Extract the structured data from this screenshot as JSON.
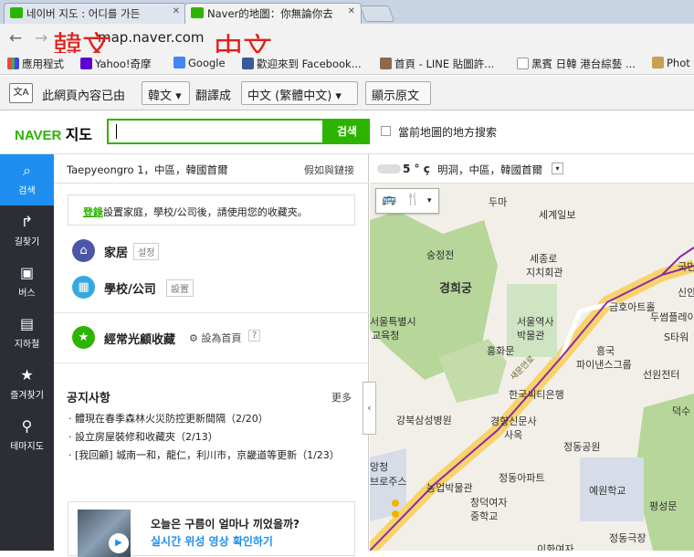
{
  "browser": {
    "tabs": [
      {
        "title": "네이버 지도 : 어디를 가든"
      },
      {
        "title": "Naver的地圖：你無論你去"
      }
    ],
    "url": "map.naver.com",
    "overlay_korean": "韓文",
    "overlay_chinese": "中文",
    "bookmarks": [
      {
        "label": "應用程式"
      },
      {
        "label": "Yahoo!奇摩"
      },
      {
        "label": "Google"
      },
      {
        "label": "歡迎來到 Facebook..."
      },
      {
        "label": "首頁 - LINE 貼圖許..."
      },
      {
        "label": "黑賓 日韓 港台綜藝 ..."
      },
      {
        "label": "Phot"
      }
    ]
  },
  "translate_bar": {
    "text1": "此網頁內容已由",
    "source_lang": "韓文",
    "text2": "翻譯成",
    "target_lang": "中文 (繁體中文)",
    "show_original": "顯示原文"
  },
  "header": {
    "logo": "NAVER",
    "logo_suffix": "지도",
    "search_button": "검색",
    "nearby_label": "當前地圖的地方搜索"
  },
  "nav": [
    {
      "label": "검색",
      "icon": "search-icon"
    },
    {
      "label": "길찾기",
      "icon": "directions-icon"
    },
    {
      "label": "버스",
      "icon": "bus-icon"
    },
    {
      "label": "지하철",
      "icon": "subway-icon"
    },
    {
      "label": "즐겨찾기",
      "icon": "star-icon"
    },
    {
      "label": "테마지도",
      "icon": "pin-icon"
    }
  ],
  "panel": {
    "location": "Taepyeongro 1，中區，韓國首爾",
    "location_link": "假如與鏈接",
    "login_link": "登錄",
    "login_text": "設置家庭，學校/公司後，請使用您的收藏夾。",
    "home_label": "家居",
    "home_tag": "설정",
    "school_label": "學校/公司",
    "school_tag": "設置",
    "frequent_label": "經常光顧收藏",
    "set_home": "設為首頁",
    "help": "?",
    "notice_title": "공지사항",
    "notice_more": "更多",
    "notices": [
      "體現在春季森林火災防控更新間隔（2/20）",
      "設立房屋裝修和收藏夾（2/13）",
      "[我回顧] 城南一和，龍仁，利川市，京畿道等更新（1/23）"
    ],
    "banner_line1": "오늘은 구름이 얼마나 끼었을까?",
    "banner_line2": "실시간 위성 영상 확인하기"
  },
  "weather": {
    "temp": "5 ° ç",
    "text": "明洞，中區，韓國首爾"
  },
  "map": {
    "labels": [
      "두마",
      "세계일보",
      "숭정전",
      "세종로",
      "지치회관",
      "국민",
      "경희궁",
      "금호아트홀",
      "서울역사",
      "박물관",
      "두썸플레이",
      "신안",
      "서울특별시",
      "교육청",
      "홍화문",
      "흥국",
      "파이낸스그룹",
      "S타워",
      "한국씨티은행",
      "선원전터",
      "강북삼성병원",
      "경향신문사",
      "사옥",
      "덕수",
      "정동공원",
      "농업박물관",
      "정동아파트",
      "예원학교",
      "창덕여자",
      "중학교",
      "평성문",
      "정동극장",
      "이화여자",
      "새문안로",
      "앙청",
      "브로주스"
    ]
  }
}
